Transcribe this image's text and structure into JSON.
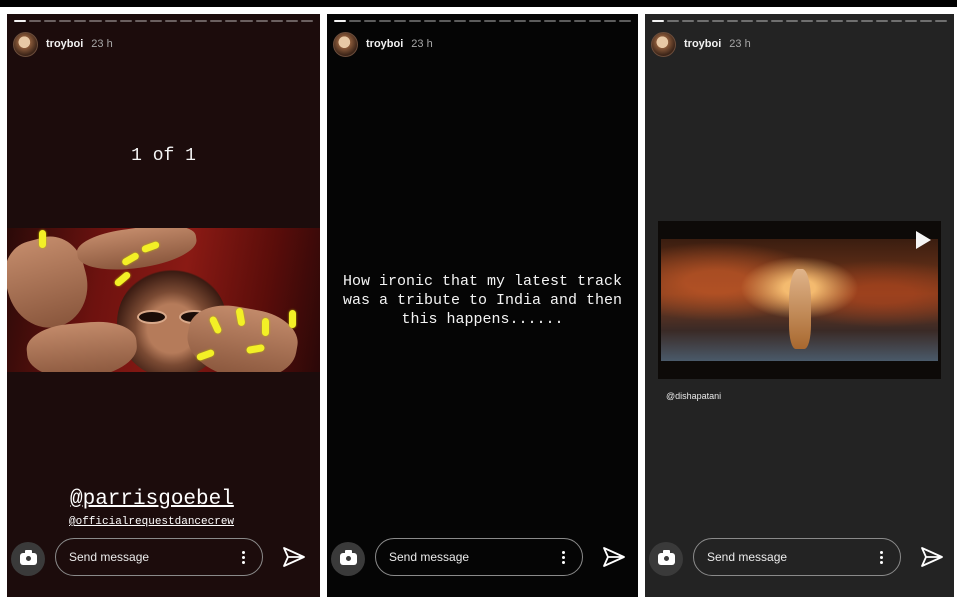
{
  "stories": [
    {
      "username": "troyboi",
      "time": "23 h",
      "progress": {
        "segments": 20,
        "completed": 1
      },
      "text": "1 of 1",
      "mention_primary": "@parrisgoebel",
      "mention_secondary": "@officialrequestdancecrew",
      "message_placeholder": "Send message"
    },
    {
      "username": "troyboi",
      "time": "23 h",
      "progress": {
        "segments": 20,
        "completed": 1
      },
      "text": "How ironic that my latest track was a tribute to India and then this happens......",
      "message_placeholder": "Send message"
    },
    {
      "username": "troyboi",
      "time": "23 h",
      "progress": {
        "segments": 20,
        "completed": 1
      },
      "mention": "@dishapatani",
      "message_placeholder": "Send message"
    }
  ],
  "icons": {
    "camera": "camera-icon",
    "more": "more-vertical-icon",
    "send": "send-icon",
    "play": "play-icon"
  },
  "colors": {
    "panel1_bg": "#1c0c0c",
    "panel2_bg": "#050505",
    "panel3_bg": "#232323",
    "nail_yellow": "#f3f026"
  }
}
